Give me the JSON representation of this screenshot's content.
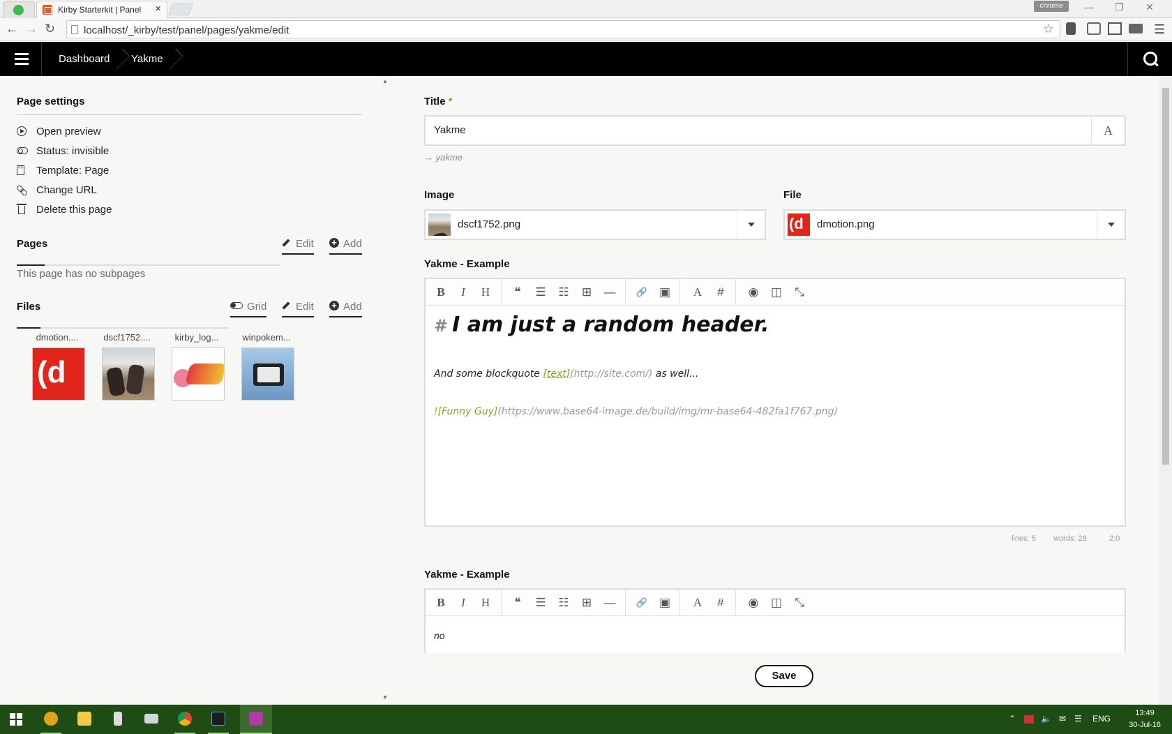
{
  "browser": {
    "tab_title": "Kirby Starterkit | Panel",
    "tab_close": "×",
    "profile_badge": "chrome",
    "url": "localhost/_kirby/test/panel/pages/yakme/edit"
  },
  "topbar": {
    "breadcrumbs": [
      "Dashboard",
      "Yakme"
    ]
  },
  "sidebar": {
    "settings_title": "Page settings",
    "settings_items": [
      {
        "label": "Open preview",
        "icon": "preview-icon"
      },
      {
        "label": "Status: invisible",
        "icon": "toggle-icon"
      },
      {
        "label": "Template: Page",
        "icon": "template-icon"
      },
      {
        "label": "Change URL",
        "icon": "link-icon"
      },
      {
        "label": "Delete this page",
        "icon": "trash-icon"
      }
    ],
    "pages": {
      "title": "Pages",
      "edit_label": "Edit",
      "add_label": "Add",
      "empty_text": "This page has no subpages"
    },
    "files": {
      "title": "Files",
      "grid_label": "Grid",
      "edit_label": "Edit",
      "add_label": "Add",
      "items": [
        {
          "name": "dmotion...."
        },
        {
          "name": "dscf1752...."
        },
        {
          "name": "kirby_log..."
        },
        {
          "name": "winpokem..."
        }
      ]
    }
  },
  "form": {
    "title_label": "Title",
    "title_required": "*",
    "title_value": "Yakme",
    "title_icon_glyph": "A",
    "slug": "→ yakme",
    "image_label": "Image",
    "image_value": "dscf1752.png",
    "file_label": "File",
    "file_value": "dmotion.png",
    "editor1": {
      "label": "Yakme - Example",
      "heading_hash": "#",
      "heading_text": "I am just a random header.",
      "line2_text": "And some blockquote ",
      "line2_link": "[text]",
      "line2_url": "(http://site.com/)",
      "line2_tail": " as well...",
      "line3_alt": "![Funny Guy]",
      "line3_url": "(https://www.base64-image.de/build/img/mr-base64-482fa1f767.png)",
      "status_lines": "lines: 5",
      "status_words": "words: 28",
      "status_cursor": "2:0"
    },
    "editor2": {
      "label": "Yakme - Example",
      "body": "no"
    },
    "save_label": "Save",
    "dmotion_glyph": "(d"
  },
  "toolbar_glyphs": {
    "bold": "B",
    "italic": "I",
    "heading": "H",
    "quote": "❝",
    "ul": "☰",
    "ol": "☷",
    "table": "⊞",
    "hr": "—",
    "link": "🔗",
    "image": "▣",
    "font": "A",
    "hash": "#",
    "preview": "◉",
    "columns": "◫",
    "fullscreen": "⤡"
  },
  "taskbar": {
    "lang": "ENG",
    "time": "13:49",
    "date": "30-Jul-16"
  },
  "colors": {
    "accent_green": "#8aa326",
    "topbar_bg": "#000000",
    "taskbar_bg": "#1f4c14",
    "dmotion_red": "#e1251b"
  }
}
